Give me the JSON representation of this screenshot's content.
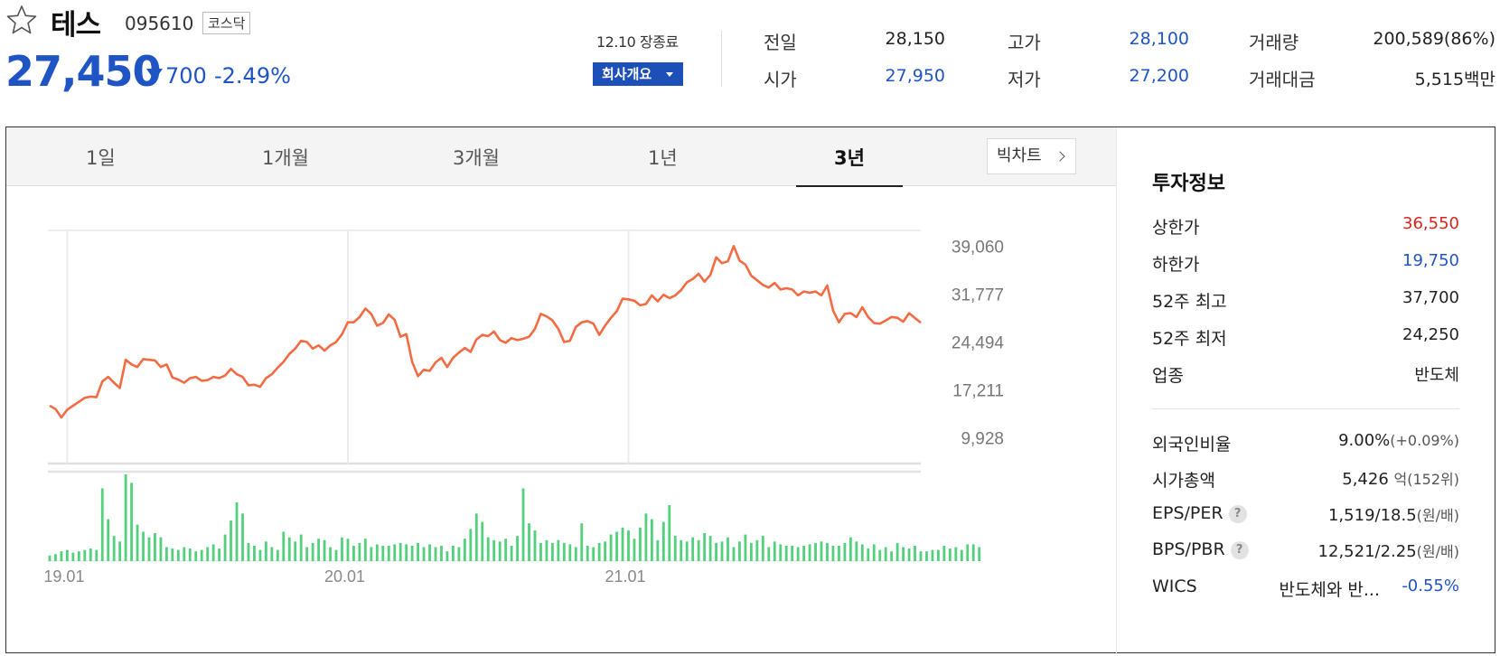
{
  "stock": {
    "name": "테스",
    "code": "095610",
    "market": "코스닥",
    "price": "27,450",
    "change_amount": "700",
    "change_percent": "-2.49%",
    "close_label": "12.10 장종료",
    "company_btn": "회사개요",
    "colors": {
      "down": "#1f54c4",
      "up": "#d8261d",
      "line": "#f36b43",
      "volume": "#52d07b"
    }
  },
  "quote": {
    "prev_label": "전일",
    "prev": "28,150",
    "open_label": "시가",
    "open": "27,950",
    "high_label": "고가",
    "high": "28,100",
    "low_label": "저가",
    "low": "27,200",
    "volume_label": "거래량",
    "volume": "200,589(86%)",
    "value_label": "거래대금",
    "value": "5,515백만"
  },
  "tabs": [
    "1일",
    "1개월",
    "3개월",
    "1년",
    "3년"
  ],
  "active_tab": "3년",
  "bigchart_label": "빅차트",
  "chart_data": {
    "type": "line",
    "y_ticks": [
      "39,060",
      "31,777",
      "24,494",
      "17,211",
      "9,928"
    ],
    "y_tick_values": [
      39060,
      31777,
      24494,
      17211,
      9928
    ],
    "x_ticks": [
      "19.01",
      "20.01",
      "21.01"
    ],
    "x_tick_index": [
      3,
      51,
      99
    ],
    "ylim": [
      6000,
      41500
    ],
    "grid": true,
    "series": [
      {
        "values": [
          14800,
          14300,
          13000,
          14200,
          14800,
          15400,
          16000,
          16200,
          16100,
          18500,
          19200,
          18300,
          17500,
          21800,
          21100,
          20700,
          21900,
          21800,
          21700,
          20700,
          21100,
          19100,
          18800,
          18300,
          19000,
          19200,
          18600,
          18700,
          19200,
          19000,
          19400,
          20400,
          19600,
          19200,
          17900,
          18000,
          17700,
          19000,
          19600,
          20600,
          21500,
          22700,
          23500,
          24700,
          24500,
          23500,
          24000,
          23200,
          24000,
          24500,
          25700,
          27500,
          27500,
          28300,
          29600,
          28800,
          27000,
          27400,
          28700,
          27900,
          25300,
          25700,
          21500,
          19300,
          20300,
          20100,
          21400,
          22100,
          20700,
          22100,
          22900,
          23600,
          23000,
          24900,
          25600,
          25400,
          26100,
          24800,
          24400,
          25100,
          24800,
          25000,
          25300,
          26500,
          28800,
          28400,
          27800,
          26500,
          24500,
          24700,
          26800,
          27500,
          27700,
          27300,
          25600,
          27000,
          28200,
          29200,
          31100,
          31000,
          30800,
          30100,
          30300,
          31600,
          30700,
          31700,
          31200,
          31600,
          32400,
          33600,
          34100,
          34900,
          33700,
          34700,
          37400,
          36500,
          36800,
          39100,
          36900,
          36300,
          34600,
          33900,
          33200,
          32800,
          33500,
          32500,
          32700,
          32500,
          31600,
          32200,
          32000,
          32200,
          31600,
          33100,
          29300,
          27500,
          28800,
          28900,
          28300,
          29800,
          28300,
          27400,
          27300,
          27800,
          28300,
          28200,
          27600,
          28900,
          28150,
          27450
        ]
      }
    ],
    "volume": [
      4,
      5,
      7,
      8,
      6,
      7,
      8,
      9,
      8,
      52,
      30,
      18,
      14,
      62,
      56,
      26,
      21,
      17,
      20,
      17,
      10,
      9,
      8,
      10,
      9,
      7,
      8,
      10,
      12,
      9,
      19,
      29,
      42,
      34,
      13,
      11,
      8,
      14,
      10,
      8,
      21,
      17,
      14,
      19,
      10,
      13,
      16,
      15,
      10,
      8,
      17,
      16,
      11,
      13,
      16,
      10,
      12,
      11,
      11,
      12,
      13,
      12,
      11,
      13,
      10,
      12,
      10,
      11,
      7,
      11,
      10,
      16,
      23,
      34,
      28,
      17,
      15,
      14,
      16,
      11,
      18,
      52,
      27,
      22,
      13,
      15,
      13,
      15,
      13,
      12,
      10,
      27,
      11,
      10,
      13,
      14,
      19,
      21,
      24,
      22,
      16,
      24,
      34,
      30,
      15,
      28,
      40,
      18,
      15,
      14,
      17,
      15,
      20,
      18,
      13,
      14,
      17,
      10,
      14,
      19,
      13,
      15,
      18,
      10,
      14,
      12,
      11,
      11,
      10,
      11,
      12,
      13,
      14,
      13,
      11,
      11,
      13,
      17,
      14,
      12,
      9,
      12,
      8,
      10,
      7,
      13,
      10,
      9,
      11,
      7,
      7,
      8,
      8,
      11,
      9,
      10,
      8,
      12,
      12,
      10
    ]
  },
  "invest": {
    "title": "투자정보",
    "rows": [
      {
        "k": "상한가",
        "v": "36,550"
      },
      {
        "k": "하한가",
        "v": "19,750"
      },
      {
        "k": "52주 최고",
        "v": "37,700"
      },
      {
        "k": "52주 최저",
        "v": "24,250"
      },
      {
        "k": "업종",
        "v": "반도체"
      }
    ],
    "foreign_label": "외국인비율",
    "foreign_value": "9.00%",
    "foreign_change": "(+0.09%)",
    "mktcap_label": "시가총액",
    "mktcap_value": "5,426",
    "mktcap_unit": "억",
    "mktcap_rank": "(152위)",
    "eps_label": "EPS/PER",
    "eps_value": "1,519/18.5",
    "eps_unit": "(원/배)",
    "bps_label": "BPS/PBR",
    "bps_value": "12,521/2.25",
    "bps_unit": "(원/배)",
    "help_mark": "?",
    "wics_label": "WICS",
    "wics_name": "반도체와 반...",
    "wics_change": "-0.55%"
  }
}
